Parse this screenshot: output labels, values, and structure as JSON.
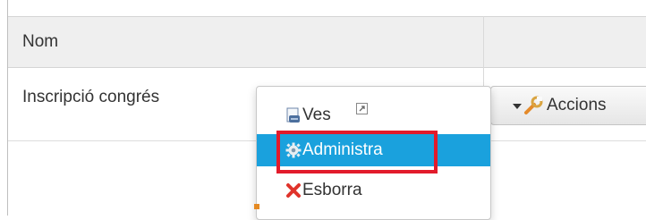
{
  "table": {
    "header": {
      "name_col": "Nom"
    },
    "rows": [
      {
        "name": "Inscripció congrés"
      }
    ]
  },
  "actions_button": {
    "label": "Accions",
    "icon": "wrench-icon",
    "caret": "caret-down-icon"
  },
  "dropdown_menu": {
    "items": [
      {
        "label": "Ves",
        "icon": "document-icon",
        "extra_icon": "external-link-icon",
        "state": "normal"
      },
      {
        "label": "Administra",
        "icon": "gear-icon",
        "state": "highlighted"
      },
      {
        "label": "Esborra",
        "icon": "delete-x-icon",
        "state": "normal"
      }
    ]
  },
  "colors": {
    "menu_highlight": "#1aa1dd",
    "annotation_box": "#e21b2b",
    "header_bg": "#efefef",
    "delete_icon": "#e0332b"
  }
}
